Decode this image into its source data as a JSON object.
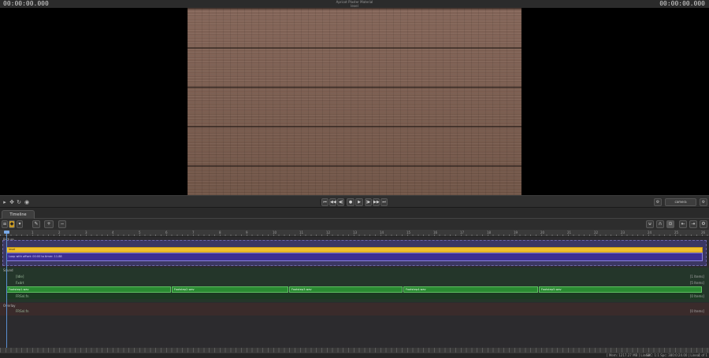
{
  "window": {
    "timecode_left": "00:00:00.000",
    "timecode_right": "00:00:00.000",
    "title_line1": "Apricot Plaster Material",
    "title_line2": "level"
  },
  "viewer": {
    "image": "brick-wall-texture"
  },
  "transport": {
    "buttons": [
      "⏮",
      "◀◀",
      "◀|",
      "●",
      "▶",
      "|▶",
      "▶▶",
      "⏭"
    ],
    "right_label": "camera"
  },
  "timeline": {
    "tab": "Timeline",
    "ruler_ticks": [
      "1",
      "2",
      "3",
      "4",
      "5",
      "6",
      "7",
      "8",
      "9",
      "10",
      "11",
      "12",
      "13",
      "14",
      "15",
      "16",
      "17",
      "18",
      "19",
      "20",
      "21",
      "22",
      "23",
      "24",
      "25",
      "26"
    ],
    "picture": {
      "label": "Picture",
      "yellow_clip": "level",
      "purple_clip": "Loop with offset: 00:00 to timer: 11.88"
    },
    "sound": {
      "label": "Sound",
      "rows": [
        {
          "name": "[Idle]",
          "count": "[1 Items]"
        },
        {
          "name": "Fxdrt",
          "count": "[5 Items]"
        }
      ],
      "clips": [
        "Footstep1.wav",
        "Footstep2.wav",
        "Footstep3.wav",
        "Footstep4.wav",
        "Footstep5.wav"
      ],
      "sub_row": {
        "name": "FRSnl.fn",
        "count": "[0 Items]"
      }
    },
    "overlay": {
      "label": "Overlay",
      "row": {
        "name": "FRSnl.fn",
        "count": "[0 Items]"
      }
    }
  },
  "status": {
    "left": "[ Mem: 1217.27 MB ] Linear",
    "mid": "SRC: 1:1 Spc: 380:0:24.00 | Linear",
    "right": "1 of 1"
  }
}
